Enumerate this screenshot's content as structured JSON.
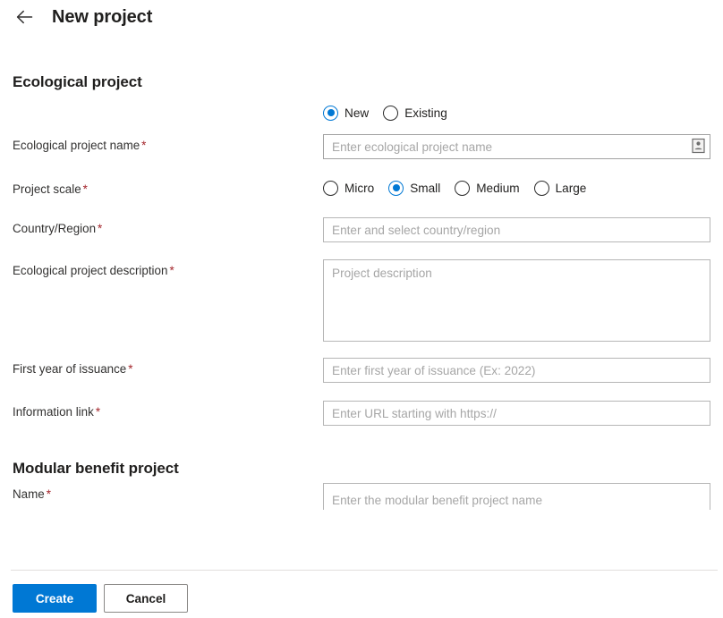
{
  "header": {
    "back_icon": "arrow-left-icon",
    "title": "New project"
  },
  "sections": {
    "ecological": {
      "title": "Ecological project",
      "mode": {
        "options": [
          {
            "label": "New",
            "checked": true
          },
          {
            "label": "Existing",
            "checked": false
          }
        ]
      },
      "project_name": {
        "label": "Ecological project name",
        "required": "*",
        "placeholder": "Enter ecological project name",
        "value": "",
        "icon": "contact-card-icon"
      },
      "project_scale": {
        "label": "Project scale",
        "required": "*",
        "options": [
          {
            "label": "Micro",
            "checked": false
          },
          {
            "label": "Small",
            "checked": true
          },
          {
            "label": "Medium",
            "checked": false
          },
          {
            "label": "Large",
            "checked": false
          }
        ]
      },
      "country_region": {
        "label": "Country/Region",
        "required": "*",
        "placeholder": "Enter and select country/region",
        "value": ""
      },
      "description": {
        "label": "Ecological project description",
        "required": "*",
        "placeholder": "Project description",
        "value": ""
      },
      "first_year": {
        "label": "First year of issuance",
        "required": "*",
        "placeholder": "Enter first year of issuance (Ex: 2022)",
        "value": ""
      },
      "information_link": {
        "label": "Information link",
        "required": "*",
        "placeholder": "Enter URL starting with https://",
        "value": ""
      }
    },
    "modular": {
      "title": "Modular benefit project",
      "name": {
        "label": "Name",
        "required": "*",
        "placeholder": "Enter the modular benefit project name",
        "value": ""
      }
    }
  },
  "footer": {
    "create_label": "Create",
    "cancel_label": "Cancel"
  },
  "colors": {
    "accent": "#0078d4",
    "required": "#a4262c",
    "text": "#201f1e",
    "placeholder": "#a6a6a6",
    "border": "#a2a2a2",
    "divider": "#e1dfdd"
  }
}
